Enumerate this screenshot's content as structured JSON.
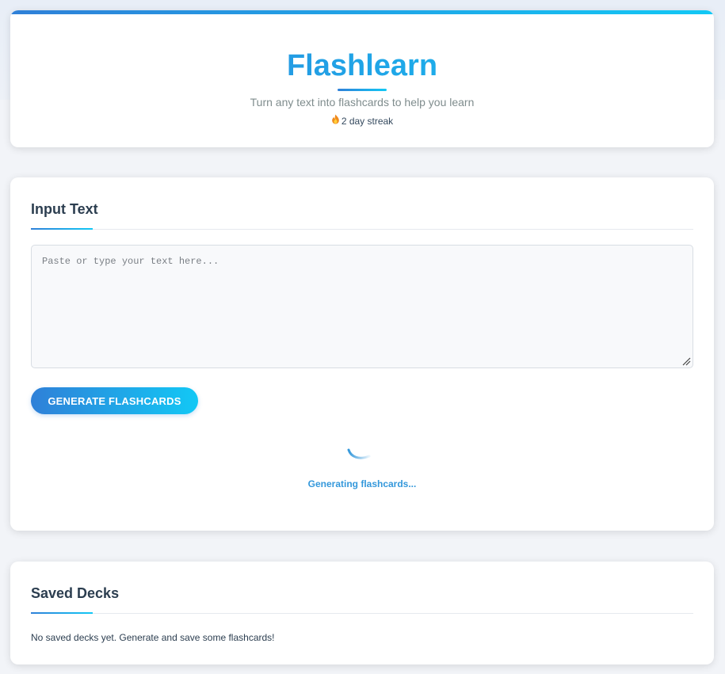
{
  "header": {
    "title": "Flashlearn",
    "subtitle": "Turn any text into flashcards to help you learn",
    "streak": "2 day streak",
    "streak_icon": "flame-icon"
  },
  "input_section": {
    "title": "Input Text",
    "textarea": {
      "value": "",
      "placeholder": "Paste or type your text here..."
    },
    "generate_button": "GENERATE FLASHCARDS",
    "loading_text": "Generating flashcards..."
  },
  "saved_decks": {
    "title": "Saved Decks",
    "empty_message": "No saved decks yet. Generate and save some flashcards!"
  },
  "colors": {
    "accent_start": "#2f80d8",
    "accent_end": "#12c8f5",
    "loading": "#3498db"
  }
}
